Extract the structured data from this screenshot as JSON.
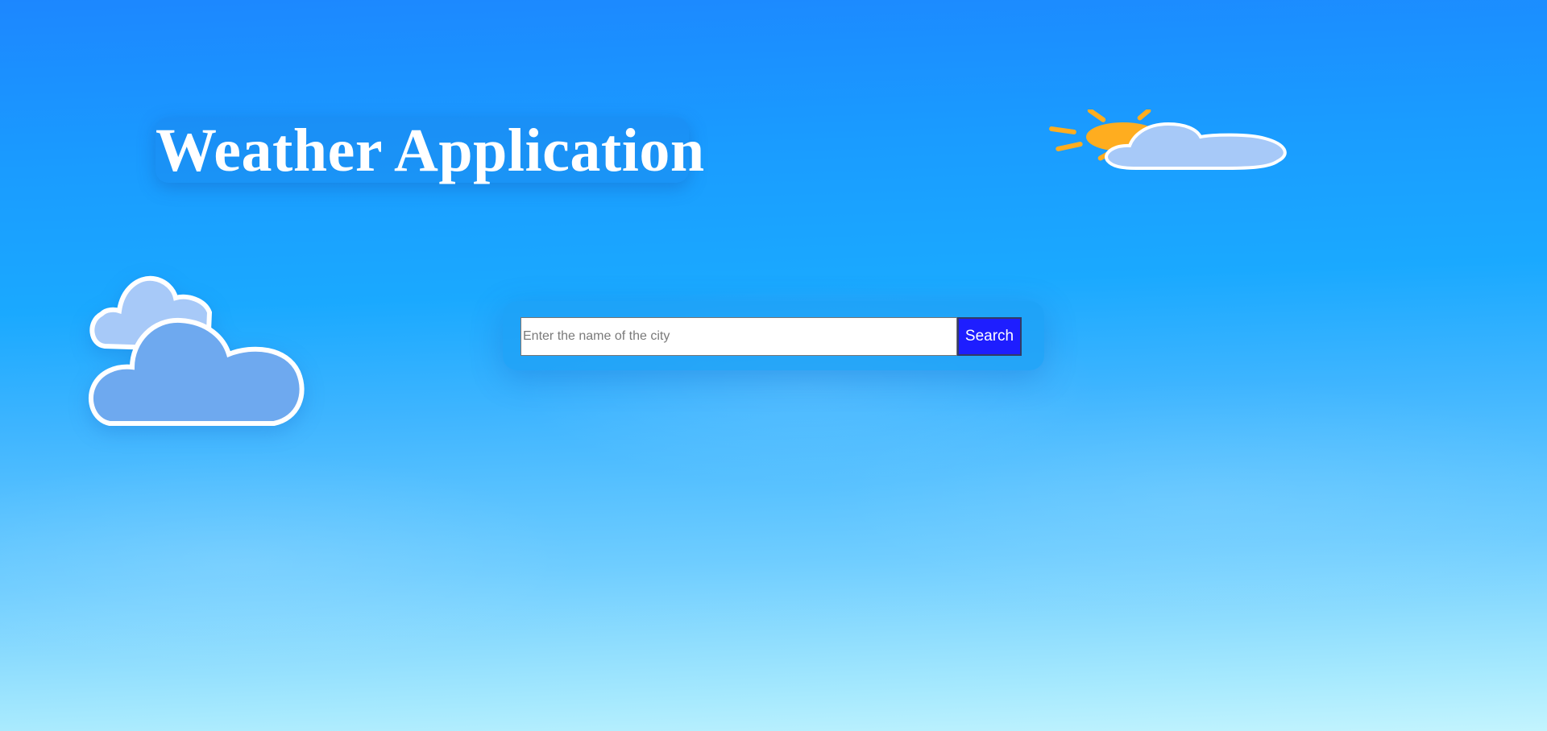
{
  "header": {
    "title": "Weather Application"
  },
  "search": {
    "placeholder": "Enter the name of the city",
    "value": "",
    "button_label": "Search"
  },
  "icons": {
    "top_right": "partly-sunny-icon",
    "left": "clouds-icon"
  },
  "colors": {
    "sky_top": "#1c87ff",
    "sky_bottom": "#c3f4fe",
    "button_bg": "#1e1eff",
    "sun": "#ffad1f",
    "cloud_light": "#a7c9f8",
    "cloud_dark": "#6ea9ef"
  }
}
